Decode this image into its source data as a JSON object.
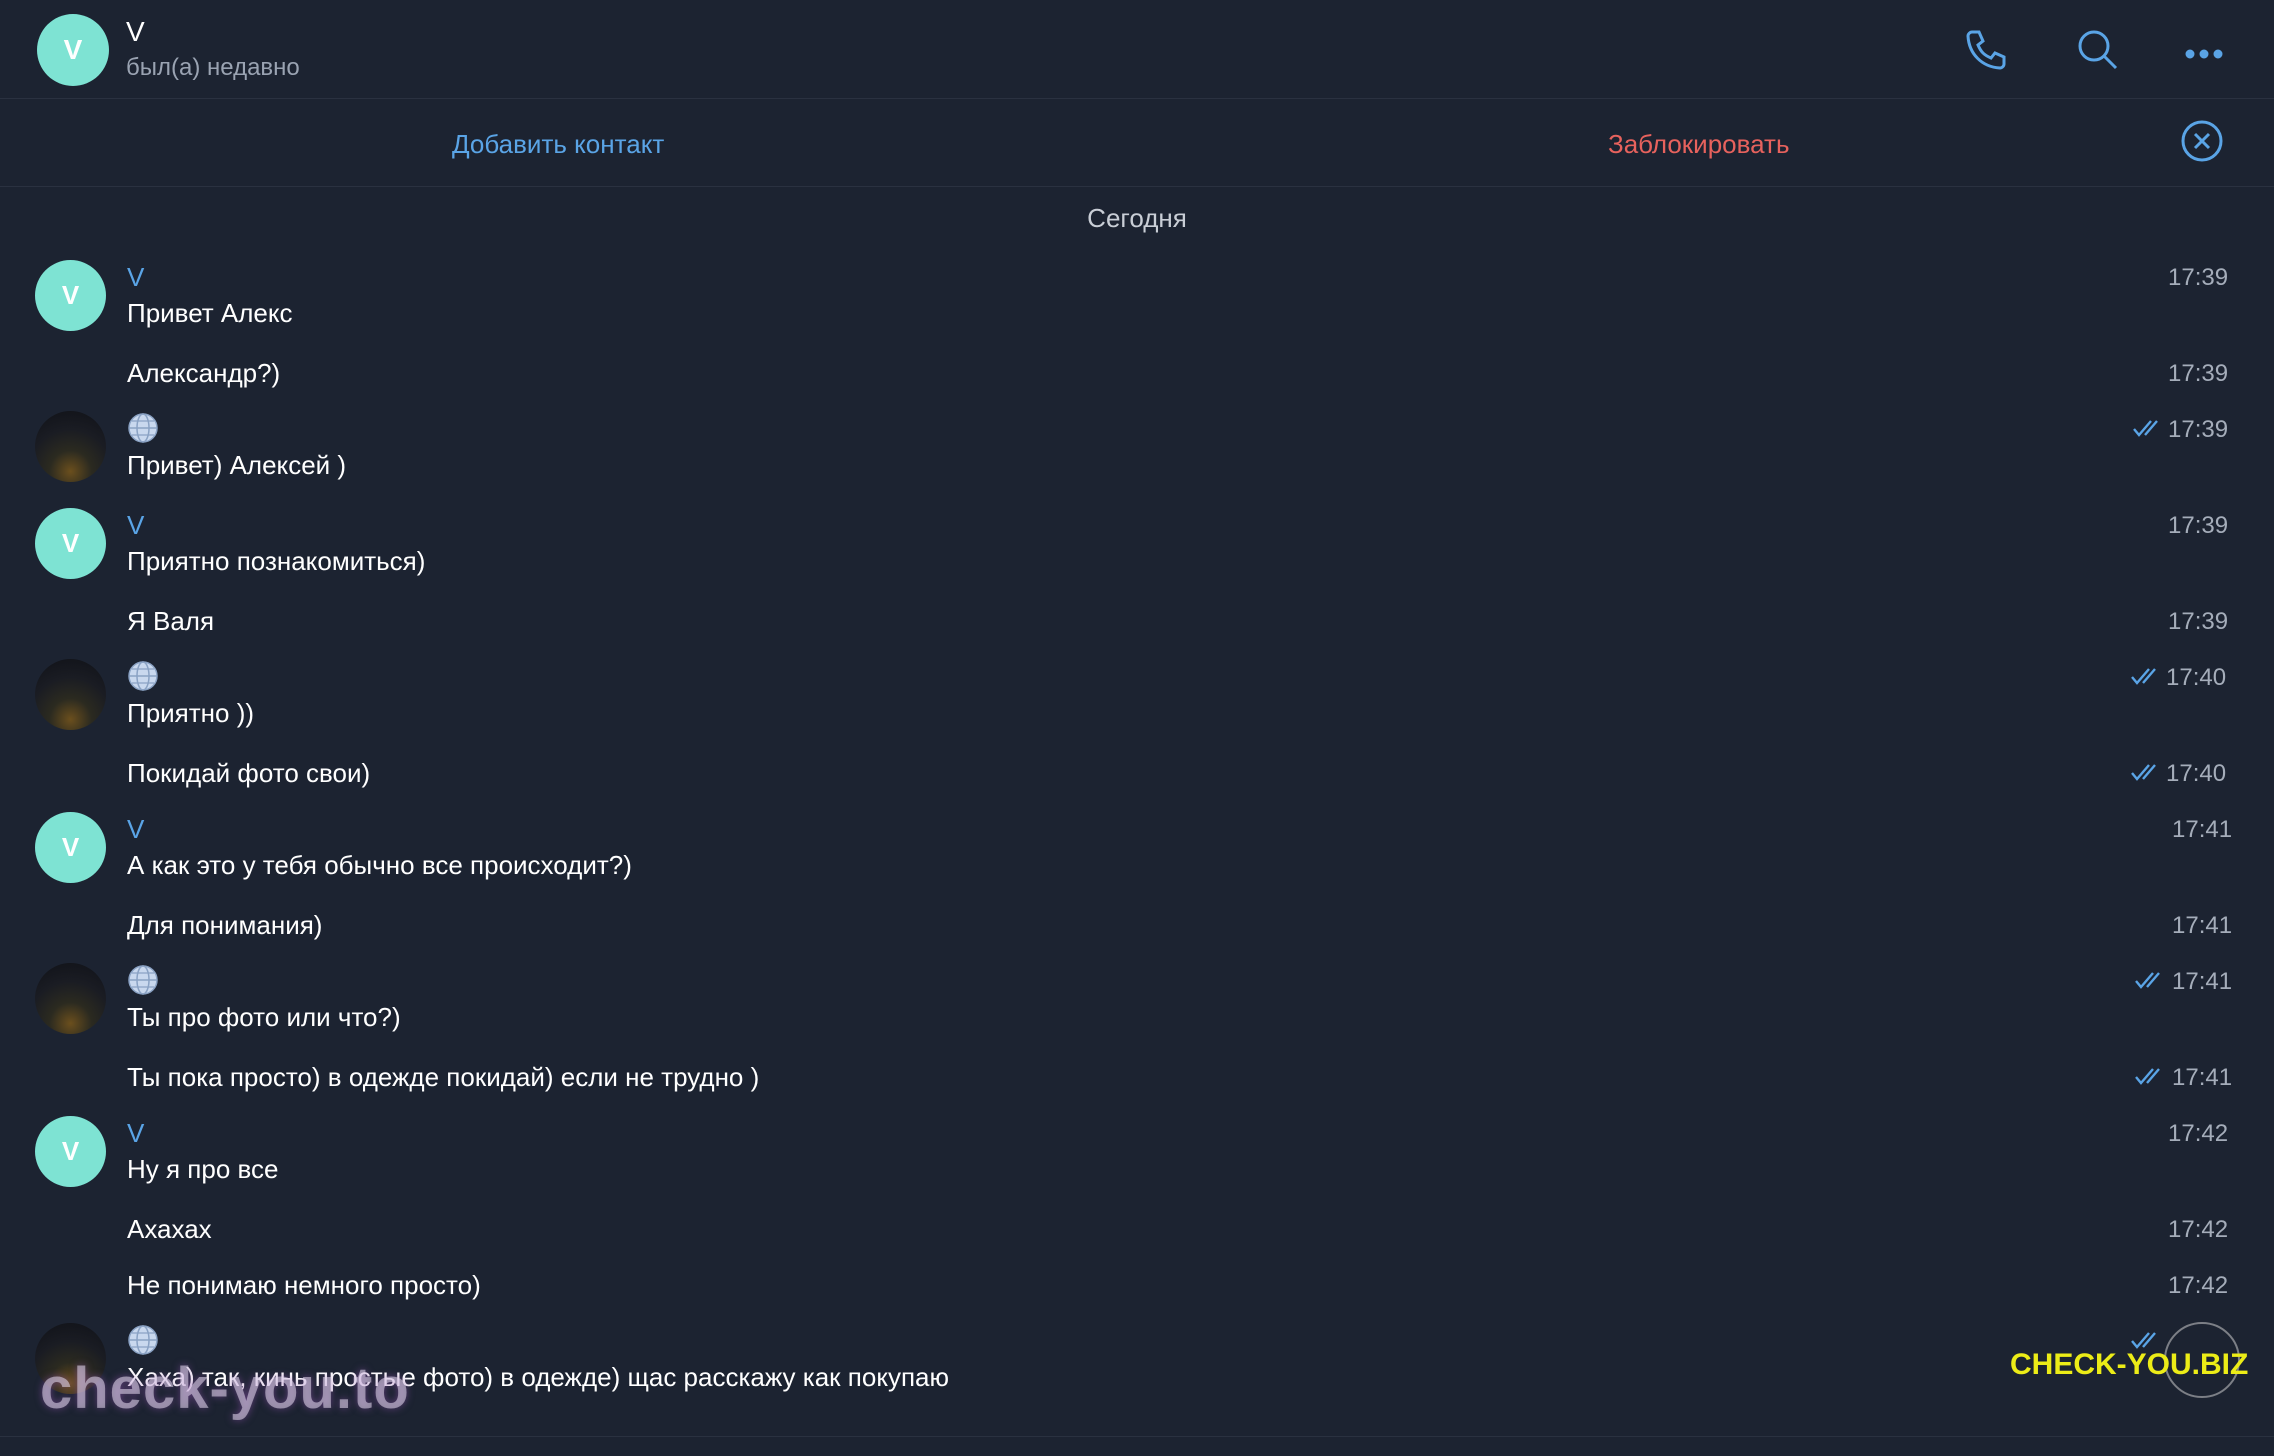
{
  "header": {
    "avatar_letter": "V",
    "name": "V",
    "status": "был(а) недавно"
  },
  "actions": {
    "add_contact": "Добавить контакт",
    "block": "Заблокировать"
  },
  "date_label": "Сегодня",
  "messages": [
    {
      "sender": "V",
      "text": "Привет Алекс",
      "time": "17:39"
    },
    {
      "text": "Александр?)",
      "time": "17:39"
    },
    {
      "text": "Привет) Алексей )",
      "time": "17:39",
      "read": true
    },
    {
      "sender": "V",
      "text": "Приятно познакомиться)",
      "time": "17:39"
    },
    {
      "text": "Я Валя",
      "time": "17:39"
    },
    {
      "text": "Приятно ))",
      "time": "17:40",
      "read": true
    },
    {
      "text": "Покидай фото свои)",
      "time": "17:40",
      "read": true
    },
    {
      "sender": "V",
      "text": "А как это у тебя обычно все происходит?)",
      "time": "17:41"
    },
    {
      "text": "Для понимания)",
      "time": "17:41"
    },
    {
      "text": "Ты про фото или что?)",
      "time": "17:41",
      "read": true
    },
    {
      "text": "Ты пока просто) в одежде покидай) если не трудно )",
      "time": "17:41",
      "read": true
    },
    {
      "sender": "V",
      "text": "Ну я про все",
      "time": "17:42"
    },
    {
      "text": "Ахахах",
      "time": "17:42"
    },
    {
      "text": "Не понимаю немного просто)",
      "time": "17:42"
    },
    {
      "text": "Хаха) так, кинь простые фото) в одежде) щас расскажу как покупаю",
      "read": true
    }
  ],
  "watermarks": {
    "left": "check-you.to",
    "right": "CHECK-YOU.BIZ"
  },
  "colors": {
    "background": "#1c2331",
    "accent": "#5aa4e6",
    "danger": "#e7625d",
    "avatar": "#7ee3d3"
  }
}
